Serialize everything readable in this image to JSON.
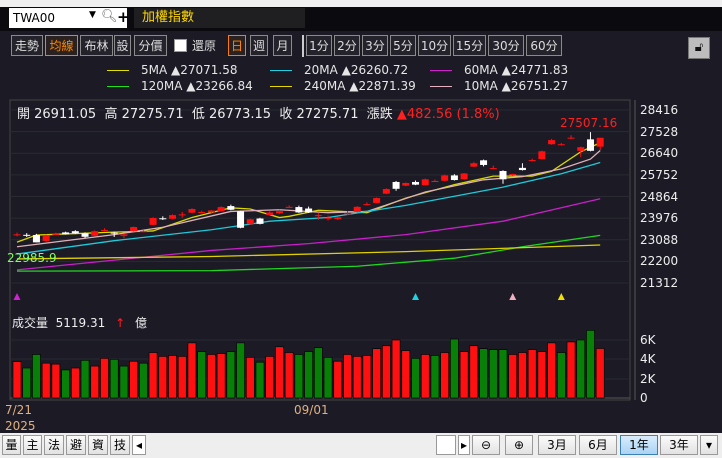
{
  "symbol": {
    "value": "TWA00",
    "search_icon": "magnifier-icon",
    "add_icon": "plus-icon"
  },
  "title": "加權指數",
  "toolbar": {
    "modes": [
      "走勢",
      "均線",
      "布林",
      "設",
      "分價"
    ],
    "active_mode": "均線",
    "restore_label": "還原",
    "periods": [
      "日",
      "週",
      "月"
    ],
    "active_period": "日",
    "minutes": [
      "1分",
      "2分",
      "3分",
      "5分",
      "10分",
      "15分",
      "30分",
      "60分"
    ],
    "lock_icon": "unlock-icon"
  },
  "legend": [
    {
      "label": "5MA ▲27071.58",
      "color": "#e0e000"
    },
    {
      "label": "20MA ▲26260.72",
      "color": "#20d0e0"
    },
    {
      "label": "60MA ▲24771.83",
      "color": "#d020d0"
    },
    {
      "label": "120MA ▲23266.84",
      "color": "#20e020"
    },
    {
      "label": "240MA ▲22871.39",
      "color": "#e8d800"
    },
    {
      "label": "10MA ▲26751.27",
      "color": "#e8b0c0"
    }
  ],
  "ohlc": {
    "open": "開 26911.05",
    "high": "高 27275.71",
    "low": "低 26773.15",
    "close": "收 27275.71",
    "change_label": "漲跌",
    "change": "▲482.56 (1.8%)"
  },
  "high_marker": "27507.16",
  "low_marker": "22985.9",
  "price_axis": [
    "28416",
    "27528",
    "26640",
    "25752",
    "24864",
    "23976",
    "23088",
    "22200",
    "21312"
  ],
  "volume": {
    "label": "成交量",
    "value": "5119.31",
    "unit": "億",
    "axis": [
      "6K",
      "4K",
      "2K",
      "0"
    ]
  },
  "dates": {
    "start": "7/21",
    "mid": "09/01",
    "year": "2025"
  },
  "bottom": {
    "tabs": [
      "量",
      "主",
      "法",
      "避",
      "資",
      "技"
    ],
    "ranges": [
      "3月",
      "6月",
      "1年",
      "3年"
    ],
    "active_range": "1年"
  },
  "colors": {
    "up": "#ff1010",
    "down": "#ffffff",
    "vol_up": "#ff1010",
    "vol_down": "#088008",
    "bg": "#1b1a25"
  },
  "chart_data": {
    "type": "candlestick",
    "ylim": [
      21312,
      28416
    ],
    "candles": [
      [
        23300,
        23380,
        23230,
        23310
      ],
      [
        23290,
        23360,
        23200,
        23280
      ],
      [
        23280,
        23330,
        22985.9,
        22980
      ],
      [
        23040,
        23300,
        23000,
        23280
      ],
      [
        23320,
        23380,
        23280,
        23330
      ],
      [
        23390,
        23420,
        23300,
        23310
      ],
      [
        23440,
        23480,
        23320,
        23350
      ],
      [
        23350,
        23390,
        23150,
        23210
      ],
      [
        23250,
        23470,
        23230,
        23440
      ],
      [
        23480,
        23560,
        23440,
        23490
      ],
      [
        23380,
        23420,
        23200,
        23370
      ],
      [
        23250,
        23330,
        23150,
        23310
      ],
      [
        23440,
        23630,
        23420,
        23610
      ],
      [
        23440,
        23480,
        23400,
        23440
      ],
      [
        23700,
        24010,
        23680,
        23980
      ],
      [
        23970,
        24050,
        23900,
        23960
      ],
      [
        23950,
        24130,
        23930,
        24100
      ],
      [
        24130,
        24230,
        24000,
        24130
      ],
      [
        24200,
        24380,
        24180,
        24350
      ],
      [
        24230,
        24280,
        24190,
        24230
      ],
      [
        24210,
        24310,
        24190,
        24290
      ],
      [
        24260,
        24460,
        24240,
        24430
      ],
      [
        24470,
        24530,
        24300,
        24320
      ],
      [
        24260,
        24280,
        23560,
        23580
      ],
      [
        23730,
        23950,
        23700,
        23930
      ],
      [
        23960,
        23990,
        23720,
        23740
      ],
      [
        24100,
        24260,
        24080,
        24210
      ],
      [
        24170,
        24320,
        24150,
        24260
      ],
      [
        24440,
        24500,
        24400,
        24440
      ],
      [
        24430,
        24490,
        24190,
        24210
      ],
      [
        24370,
        24450,
        24190,
        24210
      ],
      [
        24100,
        24200,
        23900,
        24100
      ],
      [
        23990,
        24080,
        23880,
        23990
      ],
      [
        23940,
        24030,
        23900,
        24010
      ],
      [
        24170,
        24270,
        24100,
        24170
      ],
      [
        24230,
        24470,
        24210,
        24440
      ],
      [
        24550,
        24620,
        24500,
        24550
      ],
      [
        24600,
        24820,
        24580,
        24800
      ],
      [
        24980,
        25200,
        24960,
        25170
      ],
      [
        25460,
        25500,
        25100,
        25180
      ],
      [
        25310,
        25440,
        25290,
        25420
      ],
      [
        25460,
        25520,
        25330,
        25350
      ],
      [
        25330,
        25600,
        25310,
        25570
      ],
      [
        25500,
        25560,
        25460,
        25500
      ],
      [
        25510,
        25760,
        25490,
        25730
      ],
      [
        25730,
        25780,
        25520,
        25540
      ],
      [
        25570,
        25830,
        25550,
        25810
      ],
      [
        26090,
        26280,
        26070,
        26230
      ],
      [
        26350,
        26380,
        26100,
        26160
      ],
      [
        26030,
        26130,
        25990,
        26030
      ],
      [
        25910,
        25940,
        25390,
        25570
      ],
      [
        25730,
        25800,
        25700,
        25790
      ],
      [
        26040,
        26230,
        25930,
        25950
      ],
      [
        26360,
        26420,
        26300,
        26360
      ],
      [
        26400,
        26750,
        26380,
        26720
      ],
      [
        27010,
        27230,
        26990,
        27180
      ],
      [
        27010,
        27060,
        26960,
        27010
      ],
      [
        27280,
        27380,
        27230,
        27280
      ],
      [
        26740,
        26910,
        26480,
        26890
      ],
      [
        27210,
        27507.16,
        26720,
        26740
      ],
      [
        26911.05,
        27275.71,
        26773.15,
        27275.71
      ]
    ],
    "ma": {
      "5MA": [
        [
          0,
          22990
        ],
        [
          2,
          23280
        ],
        [
          10,
          23400
        ],
        [
          14,
          23450
        ],
        [
          18,
          24000
        ],
        [
          22,
          24400
        ],
        [
          24,
          24350
        ],
        [
          27,
          24000
        ],
        [
          28,
          24050
        ],
        [
          31,
          24300
        ],
        [
          36,
          24200
        ],
        [
          40,
          24800
        ],
        [
          45,
          25350
        ],
        [
          49,
          25700
        ],
        [
          53,
          25700
        ],
        [
          55,
          25900
        ],
        [
          58,
          26700
        ],
        [
          60,
          27071.58
        ]
      ],
      "10MA": [
        [
          0,
          22800
        ],
        [
          10,
          23300
        ],
        [
          15,
          23600
        ],
        [
          22,
          24250
        ],
        [
          27,
          24320
        ],
        [
          32,
          24200
        ],
        [
          36,
          24250
        ],
        [
          42,
          25050
        ],
        [
          48,
          25550
        ],
        [
          52,
          25680
        ],
        [
          56,
          26000
        ],
        [
          59,
          26400
        ],
        [
          60,
          26751.27
        ]
      ],
      "20MA": [
        [
          0,
          22500
        ],
        [
          10,
          23050
        ],
        [
          20,
          23500
        ],
        [
          26,
          23850
        ],
        [
          32,
          24000
        ],
        [
          40,
          24500
        ],
        [
          50,
          25250
        ],
        [
          56,
          25800
        ],
        [
          60,
          26260.72
        ]
      ],
      "60MA": [
        [
          0,
          21850
        ],
        [
          10,
          22250
        ],
        [
          20,
          22650
        ],
        [
          30,
          22930
        ],
        [
          40,
          23300
        ],
        [
          50,
          23850
        ],
        [
          60,
          24771.83
        ]
      ],
      "120MA": [
        [
          0,
          21800
        ],
        [
          20,
          21820
        ],
        [
          35,
          22000
        ],
        [
          45,
          22330
        ],
        [
          52,
          22800
        ],
        [
          60,
          23266.84
        ]
      ],
      "240MA": [
        [
          0,
          22300
        ],
        [
          20,
          22400
        ],
        [
          40,
          22600
        ],
        [
          60,
          22871.39
        ]
      ]
    },
    "signals": [
      [
        0,
        "#d020d0"
      ],
      [
        41,
        "#20d0e0"
      ],
      [
        51,
        "#f0b0c0"
      ],
      [
        56,
        "#f0e000"
      ]
    ],
    "volume_k": [
      3.76,
      3.1,
      4.5,
      3.6,
      3.5,
      2.9,
      3.1,
      3.9,
      3.3,
      4.1,
      4.0,
      3.3,
      3.8,
      3.6,
      4.7,
      4.3,
      4.4,
      4.3,
      5.7,
      4.8,
      4.5,
      4.6,
      4.8,
      5.7,
      4.2,
      3.7,
      4.3,
      5.3,
      4.7,
      4.5,
      4.8,
      5.2,
      4.2,
      3.8,
      4.5,
      4.3,
      4.4,
      5.1,
      5.4,
      6.0,
      4.9,
      4.1,
      4.5,
      4.4,
      4.7,
      6.1,
      4.8,
      5.4,
      5.1,
      5.0,
      5.0,
      4.5,
      4.7,
      5.0,
      4.8,
      5.7,
      4.7,
      5.8,
      6.0,
      7.0,
      5.12
    ],
    "volume_up": [
      1,
      0,
      0,
      1,
      1,
      0,
      1,
      0,
      1,
      1,
      0,
      0,
      1,
      0,
      1,
      1,
      1,
      1,
      1,
      0,
      1,
      1,
      0,
      0,
      1,
      0,
      1,
      1,
      1,
      0,
      0,
      0,
      0,
      1,
      1,
      1,
      1,
      1,
      1,
      1,
      1,
      0,
      1,
      0,
      1,
      0,
      1,
      1,
      0,
      0,
      0,
      1,
      1,
      1,
      1,
      1,
      0,
      1,
      0,
      0,
      1
    ],
    "volume_ylim": [
      0,
      6
    ]
  }
}
